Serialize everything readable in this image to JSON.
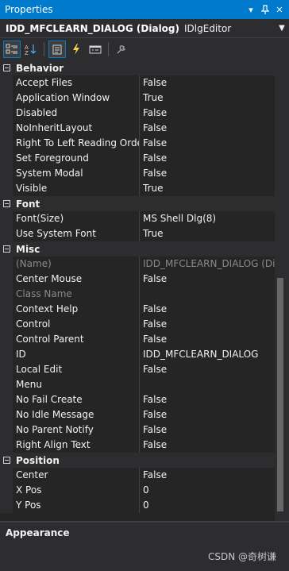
{
  "window": {
    "title": "Properties"
  },
  "object": {
    "name": "IDD_MFCLEARN_DIALOG (Dialog)",
    "type": "IDlgEditor"
  },
  "toolbar": {
    "buttons": [
      {
        "name": "categorized-icon",
        "active": true
      },
      {
        "name": "alphabetical-icon",
        "active": false
      },
      {
        "name": "properties-icon",
        "active": true
      },
      {
        "name": "events-icon",
        "active": false
      },
      {
        "name": "messages-icon",
        "active": false
      },
      {
        "name": "overrides-icon",
        "active": false
      }
    ]
  },
  "categories": [
    {
      "name": "Behavior",
      "props": [
        {
          "name": "Accept Files",
          "value": "False"
        },
        {
          "name": "Application Window",
          "value": "True"
        },
        {
          "name": "Disabled",
          "value": "False"
        },
        {
          "name": "NoInheritLayout",
          "value": "False"
        },
        {
          "name": "Right To Left Reading Orde",
          "value": "False"
        },
        {
          "name": "Set Foreground",
          "value": "False"
        },
        {
          "name": "System Modal",
          "value": "False"
        },
        {
          "name": "Visible",
          "value": "True"
        }
      ]
    },
    {
      "name": "Font",
      "props": [
        {
          "name": "Font(Size)",
          "value": "MS Shell Dlg(8)"
        },
        {
          "name": "Use System Font",
          "value": "True"
        }
      ]
    },
    {
      "name": "Misc",
      "props": [
        {
          "name": "(Name)",
          "value": "IDD_MFCLEARN_DIALOG (Dia",
          "dim": true
        },
        {
          "name": "Center Mouse",
          "value": "False"
        },
        {
          "name": "Class Name",
          "value": "",
          "dim": true
        },
        {
          "name": "Context Help",
          "value": "False"
        },
        {
          "name": "Control",
          "value": "False"
        },
        {
          "name": "Control Parent",
          "value": "False"
        },
        {
          "name": "ID",
          "value": "IDD_MFCLEARN_DIALOG"
        },
        {
          "name": "Local Edit",
          "value": "False"
        },
        {
          "name": "Menu",
          "value": ""
        },
        {
          "name": "No Fail Create",
          "value": "False"
        },
        {
          "name": "No Idle Message",
          "value": "False"
        },
        {
          "name": "No Parent Notify",
          "value": "False"
        },
        {
          "name": "Right Align Text",
          "value": "False"
        }
      ]
    },
    {
      "name": "Position",
      "props": [
        {
          "name": "Center",
          "value": "False"
        },
        {
          "name": "X Pos",
          "value": "0"
        },
        {
          "name": "Y Pos",
          "value": "0"
        }
      ]
    }
  ],
  "description": {
    "title": "Appearance"
  },
  "watermark": "CSDN @奇树谦",
  "colors": {
    "accent": "#007acc",
    "background": "#252526",
    "panel": "#2d2d30"
  }
}
